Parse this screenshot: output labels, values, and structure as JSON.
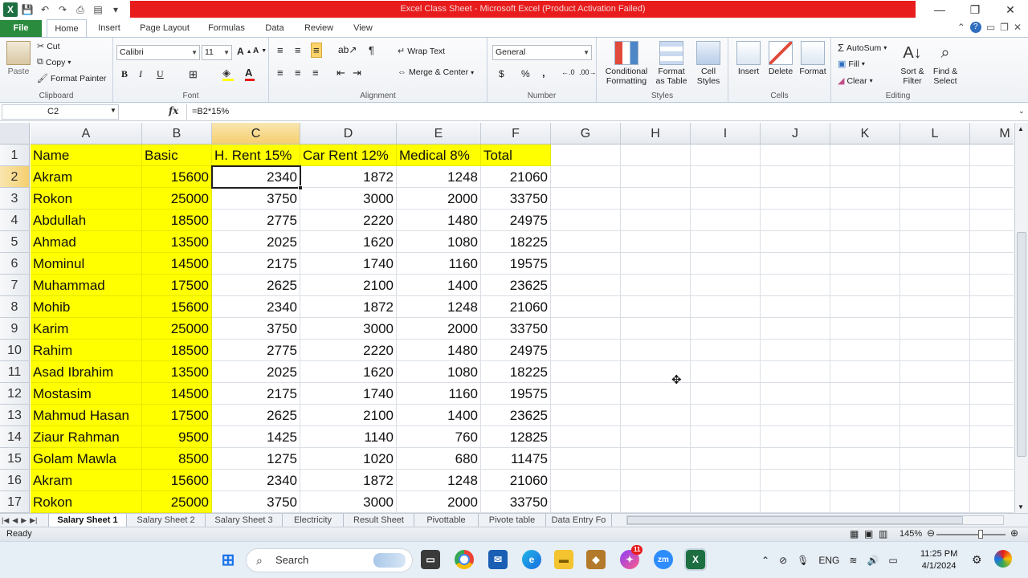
{
  "window": {
    "title": "Excel Class Sheet  -  Microsoft Excel (Product Activation Failed)",
    "controls": [
      "—",
      "❐",
      "✕"
    ]
  },
  "quick_access": [
    "💾",
    "↶",
    "↷"
  ],
  "ribbon_tabs": {
    "file": "File",
    "tabs": [
      "Home",
      "Insert",
      "Page Layout",
      "Formulas",
      "Data",
      "Review",
      "View"
    ]
  },
  "ribbon": {
    "clipboard": {
      "paste": "Paste",
      "cut": "Cut",
      "copy": "Copy",
      "format_painter": "Format Painter",
      "label": "Clipboard"
    },
    "font": {
      "name": "Calibri",
      "size": "11",
      "bold": "B",
      "italic": "I",
      "underline": "U",
      "label": "Font"
    },
    "alignment": {
      "wrap_text": "Wrap Text",
      "merge_center": "Merge & Center",
      "label": "Alignment"
    },
    "number": {
      "format": "General",
      "currency": "$",
      "percent": "%",
      "comma": ",",
      "label": "Number"
    },
    "styles": {
      "conditional": "Conditional Formatting",
      "format_table": "Format as Table",
      "cell_styles": "Cell Styles",
      "label": "Styles"
    },
    "cells": {
      "insert": "Insert",
      "delete": "Delete",
      "format": "Format",
      "label": "Cells"
    },
    "editing": {
      "autosum": "AutoSum",
      "fill": "Fill",
      "clear": "Clear",
      "sort": "Sort & Filter",
      "find": "Find & Select",
      "label": "Editing"
    }
  },
  "formula_bar": {
    "name_box": "C2",
    "fx": "fx",
    "formula": "=B2*15%"
  },
  "sheet": {
    "column_headers": [
      "A",
      "B",
      "C",
      "D",
      "E",
      "F",
      "G",
      "H",
      "I",
      "J",
      "K",
      "L",
      "M"
    ],
    "selected_column": "C",
    "selected_row": "2",
    "headers": [
      "Name",
      "Basic",
      "H. Rent 15%",
      "Car Rent 12%",
      "Medical 8%",
      "Total"
    ],
    "rows": [
      [
        "2",
        "Akram",
        "15600",
        "2340",
        "1872",
        "1248",
        "21060"
      ],
      [
        "3",
        "Rokon",
        "25000",
        "3750",
        "3000",
        "2000",
        "33750"
      ],
      [
        "4",
        "Abdullah",
        "18500",
        "2775",
        "2220",
        "1480",
        "24975"
      ],
      [
        "5",
        "Ahmad",
        "13500",
        "2025",
        "1620",
        "1080",
        "18225"
      ],
      [
        "6",
        "Mominul",
        "14500",
        "2175",
        "1740",
        "1160",
        "19575"
      ],
      [
        "7",
        "Muhammad",
        "17500",
        "2625",
        "2100",
        "1400",
        "23625"
      ],
      [
        "8",
        "Mohib",
        "15600",
        "2340",
        "1872",
        "1248",
        "21060"
      ],
      [
        "9",
        "Karim",
        "25000",
        "3750",
        "3000",
        "2000",
        "33750"
      ],
      [
        "10",
        "Rahim",
        "18500",
        "2775",
        "2220",
        "1480",
        "24975"
      ],
      [
        "11",
        "Asad Ibrahim",
        "13500",
        "2025",
        "1620",
        "1080",
        "18225"
      ],
      [
        "12",
        "Mostasim",
        "14500",
        "2175",
        "1740",
        "1160",
        "19575"
      ],
      [
        "13",
        "Mahmud Hasan",
        "17500",
        "2625",
        "2100",
        "1400",
        "23625"
      ],
      [
        "14",
        "Ziaur Rahman",
        "9500",
        "1425",
        "1140",
        "760",
        "12825"
      ],
      [
        "15",
        "Golam Mawla",
        "8500",
        "1275",
        "1020",
        "680",
        "11475"
      ],
      [
        "16",
        "Akram",
        "15600",
        "2340",
        "1872",
        "1248",
        "21060"
      ],
      [
        "17",
        "Rokon",
        "25000",
        "3750",
        "3000",
        "2000",
        "33750"
      ]
    ]
  },
  "sheet_tabs": [
    "Salary Sheet 1",
    "Salary Sheet 2",
    "Salary Sheet 3",
    "Electricity",
    "Result Sheet",
    "Pivottable",
    "Pivote table",
    "Data Entry Fo"
  ],
  "active_sheet": "Salary Sheet 1",
  "status": {
    "ready": "Ready",
    "zoom": "145%"
  },
  "taskbar": {
    "search": "Search",
    "language": "ENG",
    "time": "11:25 PM",
    "date": "4/1/2024",
    "messenger_badge": "11"
  },
  "colors": {
    "highlight": "#ffff00",
    "excel_green": "#1d6f42",
    "title_red": "#e81c1c"
  }
}
